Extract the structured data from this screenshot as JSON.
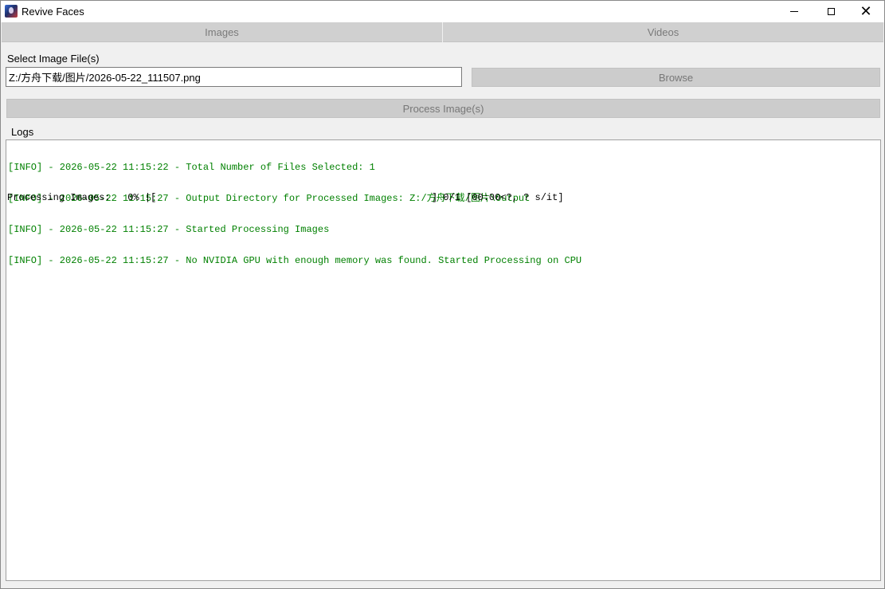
{
  "window": {
    "title": "Revive Faces",
    "icon": "revive-faces-app-icon"
  },
  "title_controls": {
    "minimize": "minimize-icon",
    "maximize": "maximize-icon",
    "close": "close-icon"
  },
  "tabs": [
    {
      "label": "Images"
    },
    {
      "label": "Videos"
    }
  ],
  "select": {
    "label": "Select Image File(s)",
    "value": "Z:/方舟下载/图片/2026-05-22_111507.png",
    "browse_label": "Browse"
  },
  "process": {
    "label": "Process Image(s)"
  },
  "logs": {
    "label": "Logs",
    "lines": [
      "[INFO] - 2026-05-22 11:15:22 - Total Number of Files Selected: 1",
      "[INFO] - 2026-05-22 11:15:27 - Output Directory for Processed Images: Z:/方舟下载/图片\\Output",
      "[INFO] - 2026-05-22 11:15:27 - Started Processing Images",
      "[INFO] - 2026-05-22 11:15:27 - No NVIDIA GPU with enough memory was found. Started Processing on CPU"
    ],
    "progress": "Processing Images:   0% |[                                                ] 0/1 [00:00<?, ? s/it]"
  },
  "colors": {
    "log_text": "#008000",
    "disabled_button": "#cccccc",
    "disabled_text": "#777777"
  }
}
